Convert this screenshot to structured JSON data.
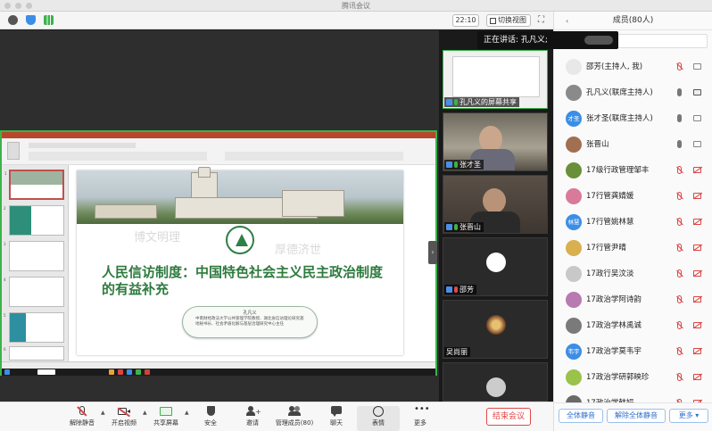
{
  "window": {
    "title": "腾讯会议"
  },
  "toolbar": {
    "clock": "22:10",
    "switch_view_label": "切换视图"
  },
  "speaking": {
    "label": "正在讲话: 孔凡义;"
  },
  "screenshare": {
    "slide_title": "人民信访制度：中国特色社会主义民主政治制度的有益补充",
    "presenter_name": "孔凡义",
    "presenter_desc": "中南财经政法大学公共管理学院教授、湖北省信访理论研究基地秘书长、社会矛盾化解与基层治理研究中心主任",
    "watermark_left": "博文明理",
    "watermark_right": "厚德济世",
    "thumb_numbers": [
      "1",
      "2",
      "3",
      "4",
      "5",
      "6"
    ]
  },
  "videos": [
    {
      "label": "孔凡义的屏幕共享"
    },
    {
      "label": "张才圣"
    },
    {
      "label": "张晋山"
    },
    {
      "label": "邵芳"
    },
    {
      "label": "吴尚丽"
    }
  ],
  "bottom_bar": {
    "unmute": "解除静音",
    "start_video": "开启视频",
    "share_screen": "共享屏幕",
    "security": "安全",
    "invite": "邀请",
    "manage_members": "管理成员(80)",
    "chat": "聊天",
    "reactions": "表情",
    "more": "更多",
    "end_meeting": "结束会议"
  },
  "panel": {
    "title": "成员(80人)",
    "members": [
      {
        "name": "邵芳(主持人, 我)",
        "avatar": "",
        "color": "#e8e8e8"
      },
      {
        "name": "孔凡义(联席主持人)",
        "avatar": "",
        "color": "#8a8a8a"
      },
      {
        "name": "张才圣(联席主持人)",
        "avatar": "才圣",
        "color": "#3b8ee6"
      },
      {
        "name": "张晋山",
        "avatar": "",
        "color": "#a07050"
      },
      {
        "name": "17级行政管理邹丰",
        "avatar": "",
        "color": "#6a8f3a"
      },
      {
        "name": "17行管龚婧媛",
        "avatar": "",
        "color": "#d97a9a"
      },
      {
        "name": "17行管姚林慧",
        "avatar": "林慧",
        "color": "#3b8ee6"
      },
      {
        "name": "17行管尹晴",
        "avatar": "",
        "color": "#d8b050"
      },
      {
        "name": "17政行吴汶淡",
        "avatar": "",
        "color": "#c8c8c8"
      },
      {
        "name": "17政治学阿诗韵",
        "avatar": "",
        "color": "#b87ab0"
      },
      {
        "name": "17政治学林禹诚",
        "avatar": "",
        "color": "#7a7a7a"
      },
      {
        "name": "17政治学莫韦宇",
        "avatar": "韦宇",
        "color": "#3b8ee6"
      },
      {
        "name": "17政治学研郭映珍",
        "avatar": "",
        "color": "#9bc24a"
      },
      {
        "name": "17政治学韩娟",
        "avatar": "",
        "color": "#6a6a6a"
      }
    ],
    "mute_all": "全体静音",
    "unmute_all": "解除全体静音",
    "more": "更多"
  },
  "colors": {
    "active_green": "#3bb34a",
    "end_red": "#e04848",
    "accent_blue": "#3b8ee6"
  }
}
